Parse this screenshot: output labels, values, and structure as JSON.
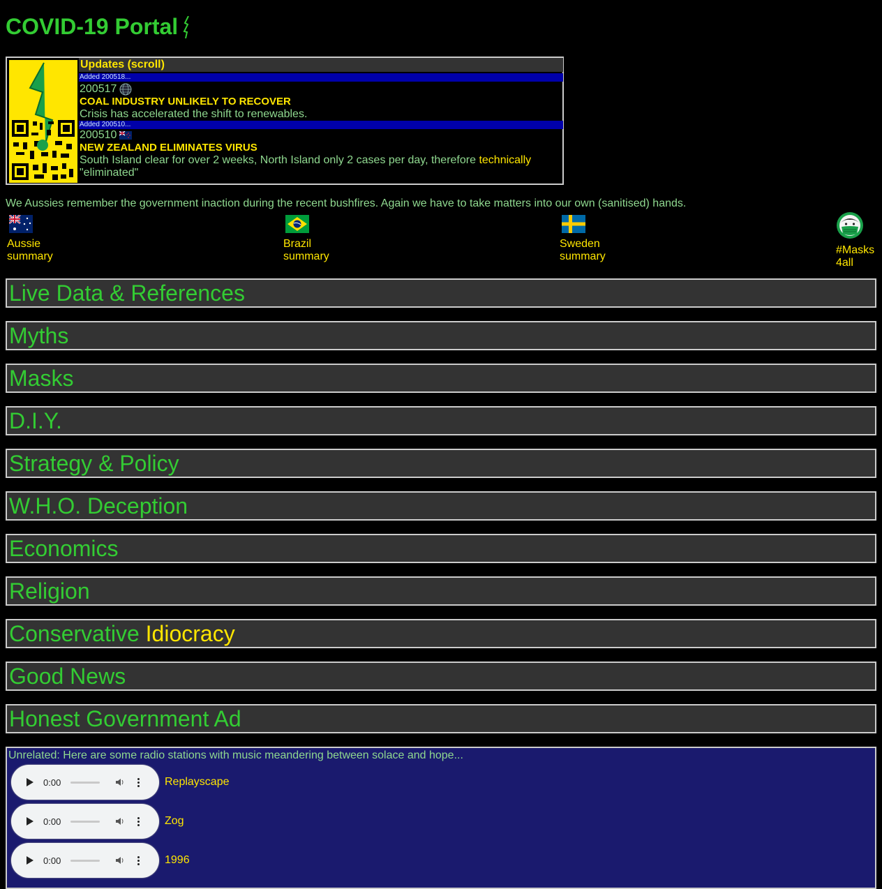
{
  "title": "COVID-19 Portal",
  "updates": {
    "heading": "Updates (scroll)",
    "items": [
      {
        "added": "Added 200518...",
        "date": "200517",
        "icon": "globe-icon",
        "headline": "COAL INDUSTRY UNLIKELY TO RECOVER",
        "desc": "Crisis has accelerated the shift to renewables."
      },
      {
        "added": "Added 200510...",
        "date": "200510",
        "icon": "nz-flag-icon",
        "headline": "NEW ZEALAND ELIMINATES VIRUS",
        "desc": "South Island clear for over 2 weeks, North Island only 2 cases per day, therefore ",
        "desc_hl": "technically",
        "desc_tail": "\"eliminated\""
      }
    ]
  },
  "intro": "We Aussies remember the government inaction during the recent bushfires. Again we have to take matters into our own (sanitised) hands.",
  "flags": [
    {
      "icon": "australia-flag-icon",
      "line1": "Aussie",
      "line2": "summary"
    },
    {
      "icon": "brazil-flag-icon",
      "line1": "Brazil",
      "line2": "summary"
    },
    {
      "icon": "sweden-flag-icon",
      "line1": "Sweden",
      "line2": "summary"
    },
    {
      "icon": "mask-face-icon",
      "line1": "#Masks",
      "line2": "4all"
    }
  ],
  "sections": [
    "Live Data & References",
    "Myths",
    "Masks",
    "D.I.Y.",
    "Strategy & Policy",
    "W.H.O. Deception",
    "Economics",
    "Religion",
    "Conservative",
    "Good News",
    "Honest Government Ad"
  ],
  "section_conservative_suffix": "Idiocracy",
  "radio": {
    "note": "Unrelated: Here are some radio stations with music meandering between solace and hope...",
    "time": "0:00",
    "stations": [
      "Replayscape",
      "Zog",
      "1996"
    ]
  },
  "colors": {
    "background": "#000000",
    "title_green": "#33cc33",
    "text_green": "#8fd88f",
    "accent_yellow": "#ffe600",
    "added_blue": "#0000aa",
    "section_bg": "#333333",
    "radio_bg": "#1a1a6e"
  }
}
